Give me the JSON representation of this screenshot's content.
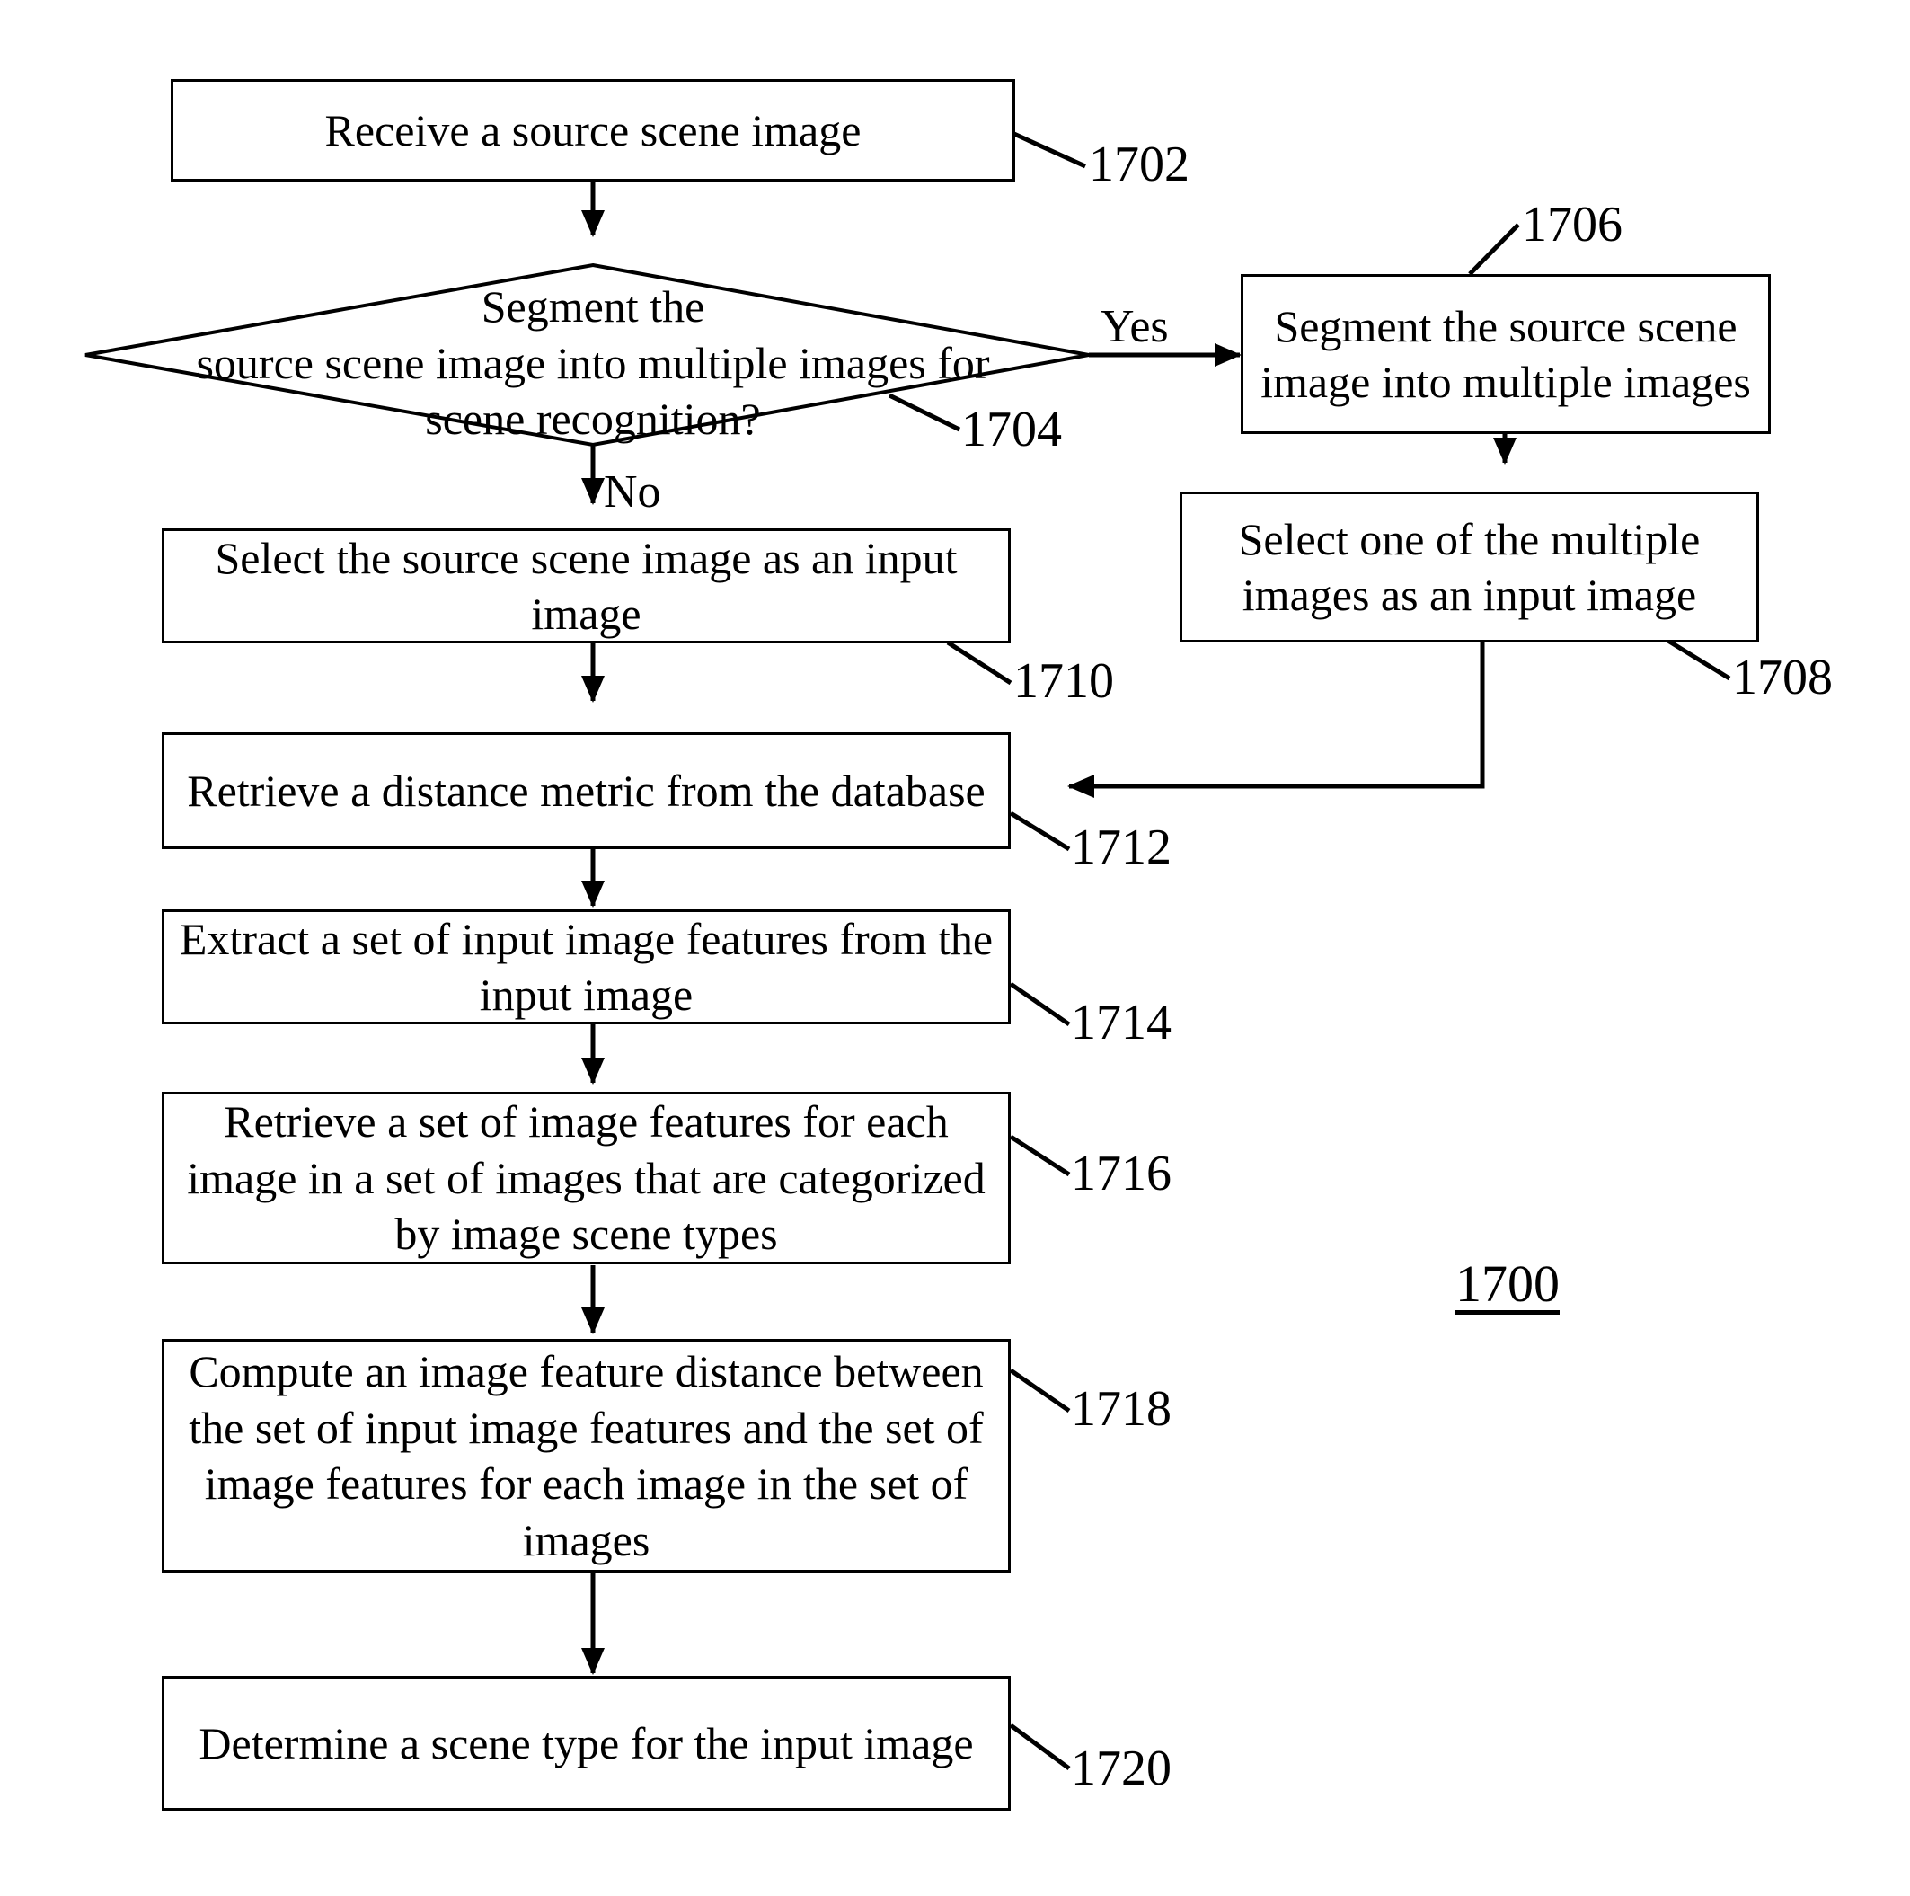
{
  "figure": {
    "number": "1700",
    "title_text": "1700"
  },
  "nodes": [
    {
      "id": "n1702",
      "kind": "process",
      "text": "Receive a source scene image",
      "ref": "1702"
    },
    {
      "id": "n1704",
      "kind": "decision",
      "text": "Segment the\nsource scene image into multiple images for\nscene recognition?",
      "ref": "1704"
    },
    {
      "id": "n1706",
      "kind": "process",
      "text": "Segment the source scene\nimage into multiple images",
      "ref": "1706"
    },
    {
      "id": "n1708",
      "kind": "process",
      "text": "Select one of the multiple\nimages as an input image",
      "ref": "1708"
    },
    {
      "id": "n1710",
      "kind": "process",
      "text": "Select the source scene image as an input\nimage",
      "ref": "1710"
    },
    {
      "id": "n1712",
      "kind": "process",
      "text": "Retrieve a distance metric from the database",
      "ref": "1712"
    },
    {
      "id": "n1714",
      "kind": "process",
      "text": "Extract a set of input image features from the\ninput image",
      "ref": "1714"
    },
    {
      "id": "n1716",
      "kind": "process",
      "text": "Retrieve a set of image features for each\nimage in a set of images that are categorized\nby image scene types",
      "ref": "1716"
    },
    {
      "id": "n1718",
      "kind": "process",
      "text": "Compute an image feature distance between\nthe set of input image features and the set of\nimage features for each image in the set of\nimages",
      "ref": "1718"
    },
    {
      "id": "n1720",
      "kind": "process",
      "text": "Determine a scene type for the input image",
      "ref": "1720"
    }
  ],
  "branches": {
    "yes_label": "Yes",
    "no_label": "No"
  },
  "style": {
    "line_color": "#000000",
    "box_fill": "#ffffff",
    "text_color": "#000000"
  }
}
